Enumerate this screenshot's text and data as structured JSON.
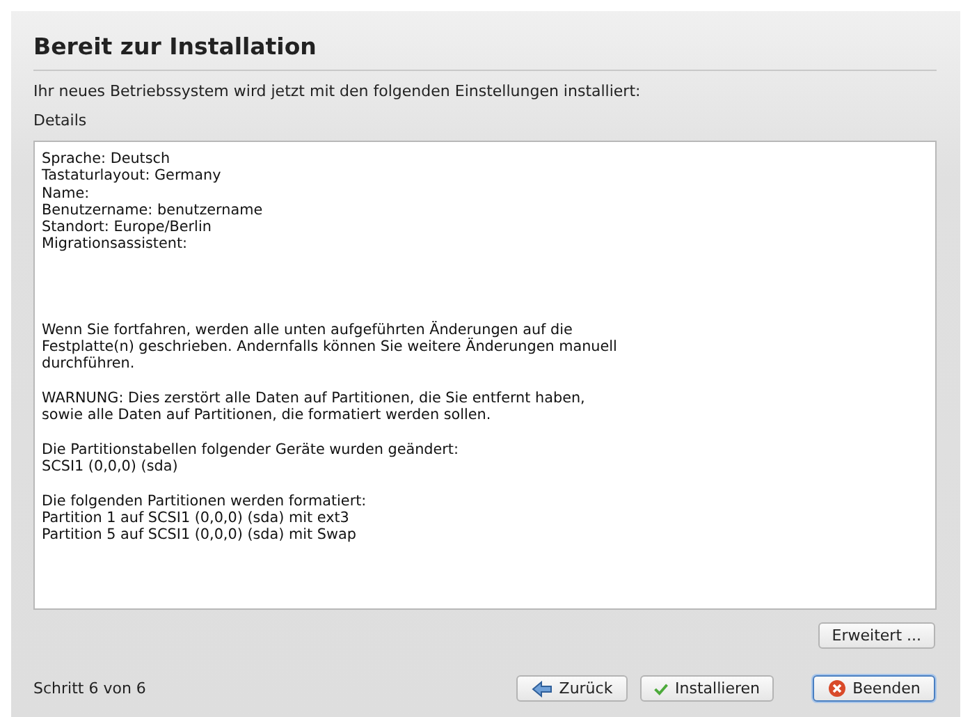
{
  "title": "Bereit zur Installation",
  "intro": "Ihr neues Betriebssystem wird jetzt mit den folgenden Einstellungen installiert:",
  "details_label": "Details",
  "details": [
    [
      "Sprache: Deutsch",
      "Tastaturlayout: Germany",
      "Name:",
      "Benutzername: benutzername",
      "Standort: Europe/Berlin",
      "Migrationsassistent:"
    ],
    [
      "Wenn Sie fortfahren, werden alle unten aufgeführten Änderungen auf die",
      "Festplatte(n) geschrieben. Andernfalls können Sie weitere Änderungen manuell",
      "durchführen."
    ],
    [
      "WARNUNG: Dies zerstört alle Daten auf Partitionen, die Sie entfernt haben,",
      "sowie alle Daten auf Partitionen, die formatiert werden sollen."
    ],
    [
      "Die Partitionstabellen folgender Geräte wurden geändert:",
      "SCSI1 (0,0,0) (sda)"
    ],
    [
      "Die folgenden Partitionen werden formatiert:",
      "Partition 1 auf SCSI1 (0,0,0) (sda) mit ext3",
      "Partition 5 auf SCSI1 (0,0,0) (sda) mit Swap"
    ]
  ],
  "advanced_button": "Erweitert ...",
  "step": "Schritt 6 von 6",
  "buttons": [
    {
      "kind": "back",
      "label": "Zurück",
      "focused": false
    },
    {
      "kind": "install",
      "label": "Installieren",
      "focused": false
    },
    {
      "kind": "quit",
      "label": "Beenden",
      "focused": true
    }
  ]
}
